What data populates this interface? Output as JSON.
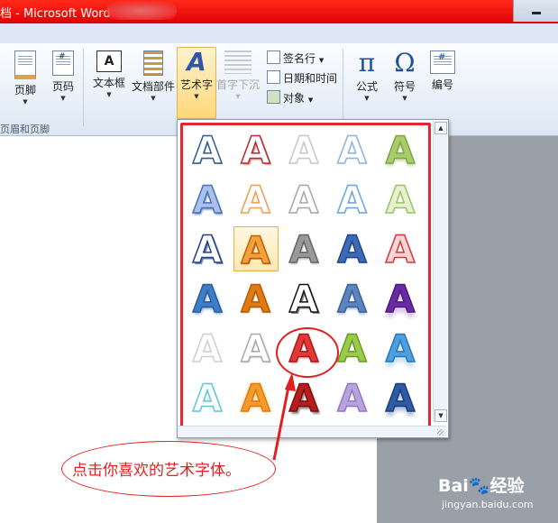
{
  "window": {
    "title_prefix": "档 - ",
    "title": "Microsoft Word",
    "titlebar_color": "#e8140e"
  },
  "ribbon": {
    "buttons": [
      {
        "id": "footer",
        "label": "页脚",
        "icon": "footer-icon",
        "has_dropdown": true
      },
      {
        "id": "page-number",
        "label": "页码",
        "icon": "page-number-icon",
        "has_dropdown": true
      },
      {
        "id": "textbox",
        "label": "文本框",
        "icon": "textbox-icon",
        "has_dropdown": true
      },
      {
        "id": "quick-parts",
        "label": "文档部件",
        "icon": "quick-parts-icon",
        "has_dropdown": true
      },
      {
        "id": "wordart",
        "label": "艺术字",
        "icon": "wordart-icon",
        "has_dropdown": true,
        "active": true
      },
      {
        "id": "drop-cap",
        "label": "首字下沉",
        "icon": "drop-cap-icon",
        "has_dropdown": true,
        "disabled": true
      },
      {
        "id": "equation",
        "label": "公式",
        "icon": "pi-icon",
        "has_dropdown": true
      },
      {
        "id": "symbol",
        "label": "符号",
        "icon": "omega-icon",
        "has_dropdown": true
      },
      {
        "id": "number",
        "label": "编号",
        "icon": "number-icon",
        "has_dropdown": false
      }
    ],
    "small_commands": [
      {
        "label": "签名行",
        "icon": "signature-line-icon",
        "has_dropdown": true
      },
      {
        "label": "日期和时间",
        "icon": "date-time-icon",
        "has_dropdown": false
      },
      {
        "label": "对象",
        "icon": "object-icon",
        "has_dropdown": true
      }
    ],
    "group_label": "页眉和页脚"
  },
  "gallery": {
    "glyph": "A",
    "rows": [
      [
        {
          "style": "outline-blue"
        },
        {
          "style": "outline-red"
        },
        {
          "style": "ghost-gray"
        },
        {
          "style": "ghost-blue"
        },
        {
          "style": "green-gradient"
        }
      ],
      [
        {
          "style": "blue-bevel"
        },
        {
          "style": "orange-outline"
        },
        {
          "style": "silver-outline"
        },
        {
          "style": "light-blue-outline"
        },
        {
          "style": "light-green"
        }
      ],
      [
        {
          "style": "navy-outline"
        },
        {
          "style": "orange-fill",
          "selected": true
        },
        {
          "style": "gray-metal"
        },
        {
          "style": "blue-solid"
        },
        {
          "style": "red-outline"
        }
      ],
      [
        {
          "style": "blue-fill"
        },
        {
          "style": "orange-solid"
        },
        {
          "style": "black-outline"
        },
        {
          "style": "steel-blue"
        },
        {
          "style": "purple-reflect"
        }
      ],
      [
        {
          "style": "light-gray"
        },
        {
          "style": "gray-bevel"
        },
        {
          "style": "red-fill",
          "highlighted": true
        },
        {
          "style": "lime-green"
        },
        {
          "style": "sky-reflect"
        }
      ],
      [
        {
          "style": "cyan-outline"
        },
        {
          "style": "orange-glow"
        },
        {
          "style": "dark-red"
        },
        {
          "style": "lavender"
        },
        {
          "style": "navy-bevel"
        }
      ]
    ]
  },
  "annotation": {
    "text": "点击你喜欢的艺术字体。",
    "color": "#e02020"
  },
  "watermark": {
    "brand": "Bai",
    "brand_tail": "经验",
    "url": "jingyan.baidu.com"
  }
}
